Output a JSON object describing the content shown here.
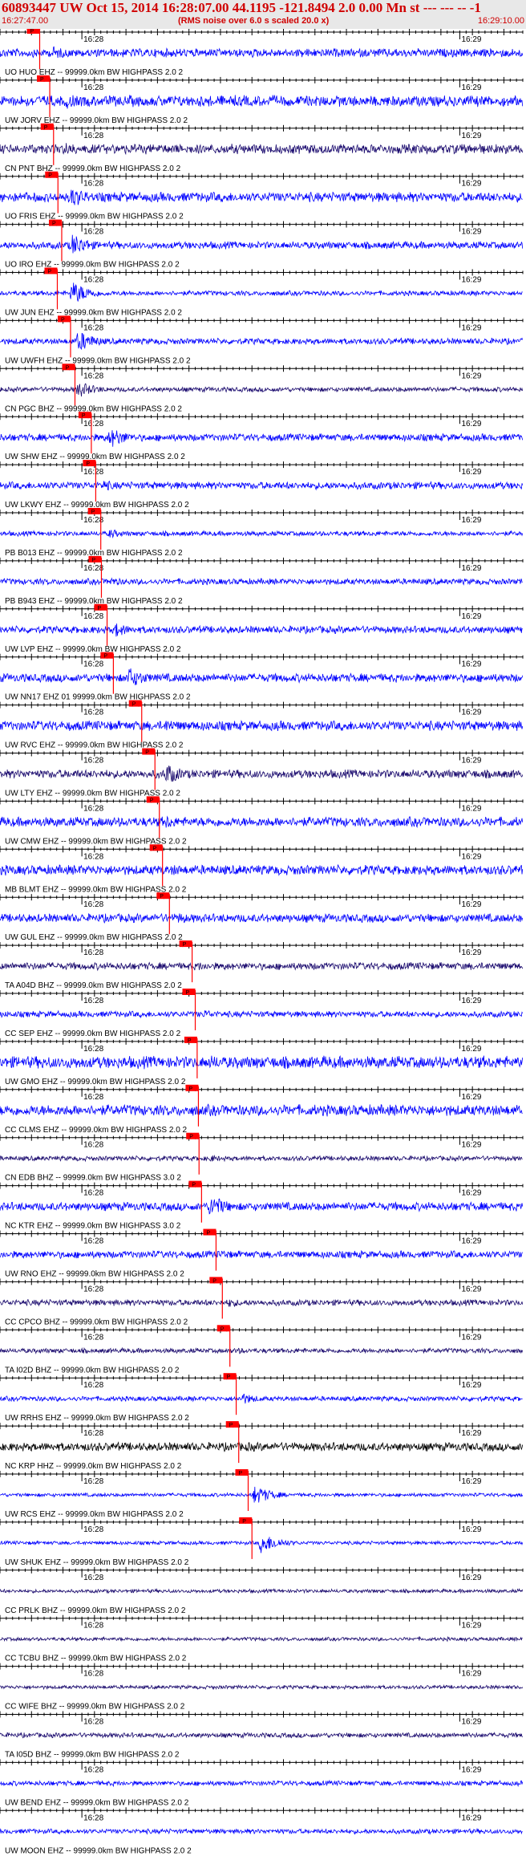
{
  "header": {
    "title": "60893447 UW Oct 15, 2014 16:28:07.00   44.1195 -121.8494  2.0 0.00 Mn st --- --- --  -1",
    "start_time": "16:27:47.00",
    "note": "(RMS noise over 6.0 s scaled 20.0 x)",
    "end_time": "16:29:10.00"
  },
  "chart_data": {
    "type": "line",
    "title": "60893447 UW Oct 15, 2014 16:28:07.00   44.1195 -121.8494  2.0 0.00 Mn st --- --- --  -1",
    "x_start": "16:27:47.00",
    "x_end": "16:29:10.00",
    "x_range_seconds": [
      0,
      83
    ],
    "time_labels": [
      {
        "label": "16:28",
        "t": 13
      },
      {
        "label": "16:29",
        "t": 73
      }
    ],
    "pick_label": "P",
    "colors": {
      "trace": "#0000ff",
      "trace_dark": "#1a0a6e",
      "trace_black": "#000000",
      "pick": "#ff0000",
      "axis": "#000000"
    },
    "traces": [
      {
        "label": "UO HUO EHZ -- 99999.0km BW  HIGHPASS  2.0  2",
        "pick_t": 6.3,
        "color": "#0000ff",
        "amp": 0.35,
        "event_t": 8,
        "event_amp": 0.6
      },
      {
        "label": "UW JORV EHZ -- 99999.0km BW  HIGHPASS  2.0  2",
        "pick_t": 7.9,
        "color": "#0000ff",
        "amp": 0.45,
        "event_t": 10,
        "event_amp": 0.7
      },
      {
        "label": "CN PNT BHZ -- 99999.0km BW  HIGHPASS  2.0  2",
        "pick_t": 8.5,
        "color": "#1a0a6e",
        "amp": 0.4,
        "event_t": 10,
        "event_amp": 0.6
      },
      {
        "label": "UO FRIS EHZ -- 99999.0km BW  HIGHPASS  2.0  2",
        "pick_t": 9.2,
        "color": "#0000ff",
        "amp": 0.4,
        "event_t": 11,
        "event_amp": 0.9
      },
      {
        "label": "UO IRO EHZ -- 99999.0km BW  HIGHPASS  2.0  2",
        "pick_t": 9.8,
        "color": "#0000ff",
        "amp": 0.3,
        "event_t": 11,
        "event_amp": 1.0
      },
      {
        "label": "UW JUN EHZ -- 99999.0km BW  HIGHPASS  2.0  2",
        "pick_t": 9.1,
        "color": "#0000ff",
        "amp": 0.2,
        "event_t": 11,
        "event_amp": 1.0
      },
      {
        "label": "UW UWFH EHZ -- 99999.0km BW  HIGHPASS  2.0  2",
        "pick_t": 11.2,
        "color": "#0000ff",
        "amp": 0.25,
        "event_t": 12,
        "event_amp": 0.9
      },
      {
        "label": "CN PGC BHZ -- 99999.0km BW  HIGHPASS  2.0  2",
        "pick_t": 11.9,
        "color": "#1a0a6e",
        "amp": 0.2,
        "event_t": 12,
        "event_amp": 0.7
      },
      {
        "label": "UW SHW EHZ -- 99999.0km BW  HIGHPASS  2.0  2",
        "pick_t": 14.5,
        "color": "#0000ff",
        "amp": 0.3,
        "event_t": 17,
        "event_amp": 0.9
      },
      {
        "label": "UW LKWY EHZ -- 99999.0km BW  HIGHPASS  2.0  2",
        "pick_t": 15.2,
        "color": "#0000ff",
        "amp": 0.3,
        "event_t": 16,
        "event_amp": 0.5
      },
      {
        "label": "PB B013 EHZ -- 99999.0km BW  HIGHPASS  2.0  2",
        "pick_t": 16.0,
        "color": "#0000ff",
        "amp": 0.2,
        "event_t": 17,
        "event_amp": 0.4
      },
      {
        "label": "PB B943 EHZ -- 99999.0km BW  HIGHPASS  2.0  2",
        "pick_t": 16.1,
        "color": "#0000ff",
        "amp": 0.25,
        "event_t": 17,
        "event_amp": 0.4
      },
      {
        "label": "UW LVP EHZ -- 99999.0km BW  HIGHPASS  2.0  2",
        "pick_t": 17.0,
        "color": "#0000ff",
        "amp": 0.3,
        "event_t": 18,
        "event_amp": 0.6
      },
      {
        "label": "UW NN17 EHZ 01 99999.0km BW  HIGHPASS  2.0  2",
        "pick_t": 18.0,
        "color": "#0000ff",
        "amp": 0.35,
        "event_t": 20,
        "event_amp": 0.9
      },
      {
        "label": "UW RVC EHZ -- 99999.0km BW  HIGHPASS  2.0  2",
        "pick_t": 22.5,
        "color": "#0000ff",
        "amp": 0.4,
        "event_t": 26,
        "event_amp": 0.6
      },
      {
        "label": "UW LTY EHZ -- 99999.0km BW  HIGHPASS  2.0  2",
        "pick_t": 24.6,
        "color": "#1a0a6e",
        "amp": 0.35,
        "event_t": 26,
        "event_amp": 0.9
      },
      {
        "label": "UW CMW EHZ -- 99999.0km BW  HIGHPASS  2.0  2",
        "pick_t": 25.3,
        "color": "#0000ff",
        "amp": 0.4,
        "event_t": 26,
        "event_amp": 0.6
      },
      {
        "label": "MB BLMT EHZ -- 99999.0km BW  HIGHPASS  2.0  2",
        "pick_t": 25.8,
        "color": "#0000ff",
        "amp": 0.4,
        "event_t": 27,
        "event_amp": 0.5
      },
      {
        "label": "UW GUL EHZ -- 99999.0km BW  HIGHPASS  2.0  2",
        "pick_t": 26.9,
        "color": "#0000ff",
        "amp": 0.35,
        "event_t": 28,
        "event_amp": 0.5
      },
      {
        "label": "TA A04D BHZ -- 99999.0km BW  HIGHPASS  2.0  2",
        "pick_t": 30.5,
        "color": "#1a0a6e",
        "amp": 0.3,
        "event_t": 31,
        "event_amp": 0.4
      },
      {
        "label": "CC SEP EHZ -- 99999.0km BW  HIGHPASS  2.0  2",
        "pick_t": 31.0,
        "color": "#0000ff",
        "amp": 0.25,
        "event_t": 32,
        "event_amp": 0.4
      },
      {
        "label": "UW GMO EHZ -- 99999.0km BW  HIGHPASS  2.0  2",
        "pick_t": 31.3,
        "color": "#0000ff",
        "amp": 0.5,
        "event_t": 33,
        "event_amp": 0.6
      },
      {
        "label": "CC CLMS EHZ -- 99999.0km BW  HIGHPASS  2.0  2",
        "pick_t": 31.5,
        "color": "#0000ff",
        "amp": 0.45,
        "event_t": 33,
        "event_amp": 0.5
      },
      {
        "label": "CN EDB BHZ -- 99999.0km BW  HIGHPASS  3.0  2",
        "pick_t": 31.6,
        "color": "#1a0a6e",
        "amp": 0.2,
        "event_t": 33,
        "event_amp": 0.3
      },
      {
        "label": "NC KTR EHZ -- 99999.0km BW  HIGHPASS  3.0  2",
        "pick_t": 32.0,
        "color": "#0000ff",
        "amp": 0.35,
        "event_t": 33,
        "event_amp": 1.0
      },
      {
        "label": "UW RNO EHZ -- 99999.0km BW  HIGHPASS  2.0  2",
        "pick_t": 34.3,
        "color": "#0000ff",
        "amp": 0.3,
        "event_t": 35,
        "event_amp": 0.4
      },
      {
        "label": "CC CPCO BHZ -- 99999.0km BW  HIGHPASS  2.0  2",
        "pick_t": 35.3,
        "color": "#1a0a6e",
        "amp": 0.25,
        "event_t": 36,
        "event_amp": 0.4
      },
      {
        "label": "TA I02D BHZ -- 99999.0km BW  HIGHPASS  2.0  2",
        "pick_t": 36.5,
        "color": "#1a0a6e",
        "amp": 0.2,
        "event_t": 37,
        "event_amp": 0.3
      },
      {
        "label": "UW RRHS EHZ -- 99999.0km BW  HIGHPASS  2.0  2",
        "pick_t": 37.5,
        "color": "#0000ff",
        "amp": 0.2,
        "event_t": 38,
        "event_amp": 0.5
      },
      {
        "label": "NC KRP HHZ -- 99999.0km BW  HIGHPASS  2.0  2",
        "pick_t": 37.9,
        "color": "#000000",
        "amp": 0.35,
        "event_t": 39,
        "event_amp": 0.4
      },
      {
        "label": "UW RCS EHZ -- 99999.0km BW  HIGHPASS  2.0  2",
        "pick_t": 39.4,
        "color": "#0000ff",
        "amp": 0.15,
        "event_t": 40,
        "event_amp": 0.8
      },
      {
        "label": "UW SHUK EHZ -- 99999.0km BW  HIGHPASS  2.0  2",
        "pick_t": 40.0,
        "color": "#0000ff",
        "amp": 0.15,
        "event_t": 41,
        "event_amp": 0.9
      },
      {
        "label": "CC PRLK BHZ -- 99999.0km BW  HIGHPASS  2.0  2",
        "pick_t": null,
        "color": "#1a0a6e",
        "amp": 0.15,
        "event_t": null,
        "event_amp": 0
      },
      {
        "label": "CC TCBU BHZ -- 99999.0km BW  HIGHPASS  2.0  2",
        "pick_t": null,
        "color": "#1a0a6e",
        "amp": 0.15,
        "event_t": null,
        "event_amp": 0
      },
      {
        "label": "CC WIFE BHZ -- 99999.0km BW  HIGHPASS  2.0  2",
        "pick_t": null,
        "color": "#1a0a6e",
        "amp": 0.15,
        "event_t": null,
        "event_amp": 0
      },
      {
        "label": "TA I05D BHZ -- 99999.0km BW  HIGHPASS  2.0  2",
        "pick_t": null,
        "color": "#1a0a6e",
        "amp": 0.2,
        "event_t": null,
        "event_amp": 0
      },
      {
        "label": "UW BEND EHZ -- 99999.0km BW  HIGHPASS  2.0  2",
        "pick_t": null,
        "color": "#0000ff",
        "amp": 0.2,
        "event_t": null,
        "event_amp": 0
      },
      {
        "label": "UW MOON EHZ -- 99999.0km BW  HIGHPASS  2.0  2",
        "pick_t": null,
        "color": "#0000ff",
        "amp": 0.2,
        "event_t": null,
        "event_amp": 0
      }
    ]
  }
}
